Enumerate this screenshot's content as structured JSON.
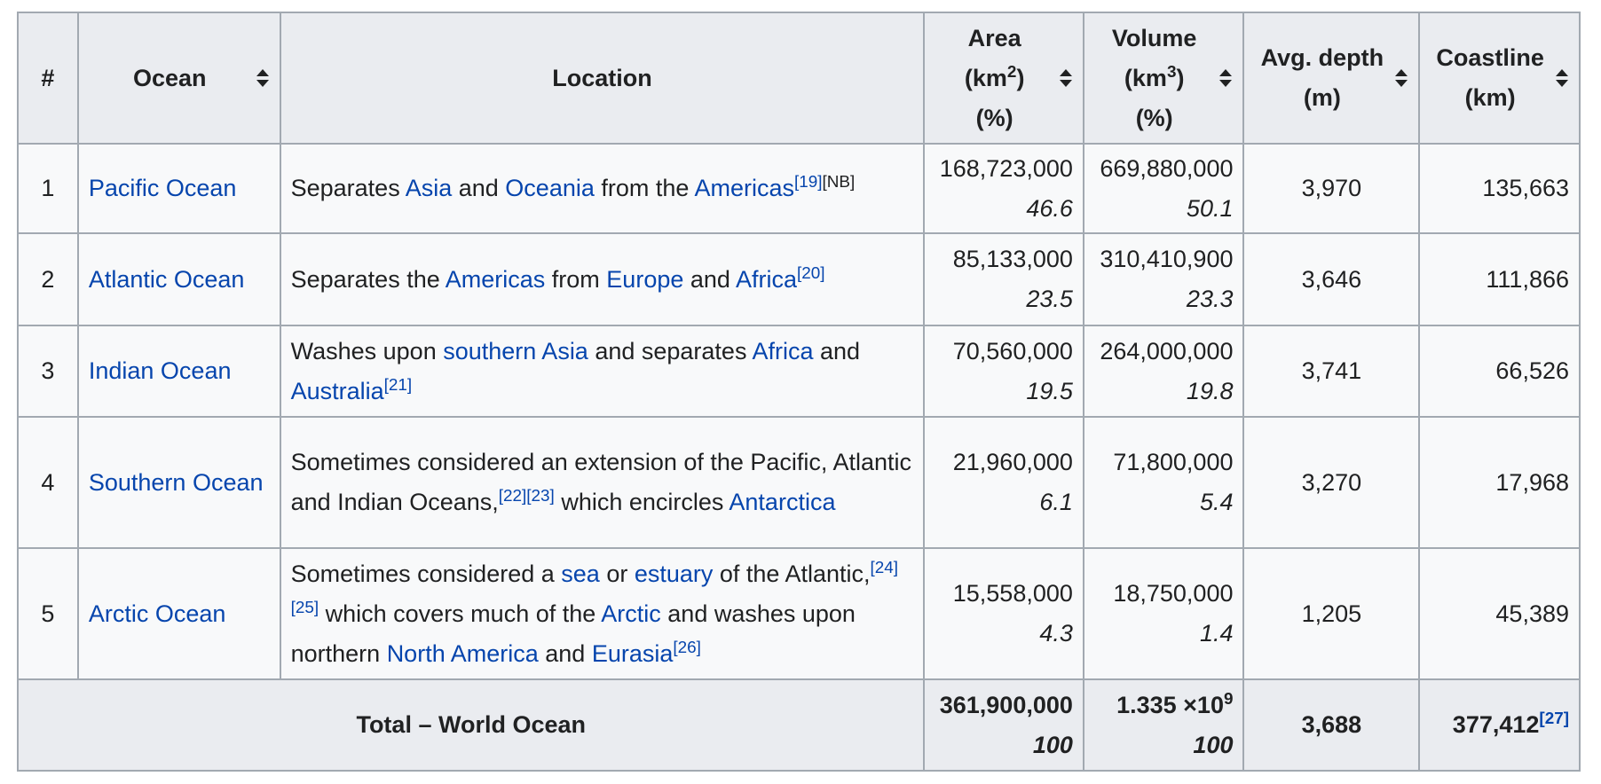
{
  "table": {
    "headers": {
      "rank": "#",
      "ocean": "Ocean",
      "location": "Location",
      "area_l1": "Area",
      "area_l2_pre": "(km",
      "area_l2_sup": "2",
      "area_l2_post": ")",
      "area_l3": "(%)",
      "volume_l1": "Volume",
      "volume_l2_pre": "(km",
      "volume_l2_sup": "3",
      "volume_l2_post": ")",
      "volume_l3": "(%)",
      "depth_l1": "Avg. depth",
      "depth_l2": "(m)",
      "coast_l1": "Coastline",
      "coast_l2": "(km)"
    },
    "rows": [
      {
        "rank": "1",
        "ocean": "Pacific Ocean",
        "location": {
          "t1": "Separates ",
          "l1": "Asia",
          "t2": " and ",
          "l2": "Oceania",
          "t3": " from the ",
          "l3": "Americas",
          "ref1": "[19]",
          "note": "[NB]"
        },
        "area": "168,723,000",
        "area_pct": "46.6",
        "volume": "669,880,000",
        "volume_pct": "50.1",
        "depth": "3,970",
        "coastline": "135,663"
      },
      {
        "rank": "2",
        "ocean": "Atlantic Ocean",
        "location": {
          "t1": "Separates the ",
          "l1": "Americas",
          "t2": " from ",
          "l2": "Europe",
          "t3": " and ",
          "l3": "Africa",
          "ref1": "[20]"
        },
        "area": "85,133,000",
        "area_pct": "23.5",
        "volume": "310,410,900",
        "volume_pct": "23.3",
        "depth": "3,646",
        "coastline": "111,866"
      },
      {
        "rank": "3",
        "ocean": "Indian Ocean",
        "location": {
          "t1": "Washes upon ",
          "l1": "southern Asia",
          "t2": " and separates ",
          "l2": "Africa",
          "t3": " and ",
          "l3": "Australia",
          "ref1": "[21]"
        },
        "area": "70,560,000",
        "area_pct": "19.5",
        "volume": "264,000,000",
        "volume_pct": "19.8",
        "depth": "3,741",
        "coastline": "66,526"
      },
      {
        "rank": "4",
        "ocean": "Southern Ocean",
        "location": {
          "t1": "Sometimes considered an extension of the Pacific, Atlantic and Indian Oceans,",
          "ref1": "[22]",
          "ref2": "[23]",
          "t2": " which encircles ",
          "l1": "Antarctica"
        },
        "area": "21,960,000",
        "area_pct": "6.1",
        "volume": "71,800,000",
        "volume_pct": "5.4",
        "depth": "3,270",
        "coastline": "17,968"
      },
      {
        "rank": "5",
        "ocean": "Arctic Ocean",
        "location": {
          "t1": "Sometimes considered a ",
          "l1": "sea",
          "t2": " or ",
          "l2": "estuary",
          "t3": " of the Atlantic,",
          "ref1": "[24]",
          "ref2": "[25]",
          "t4": " which covers much of the ",
          "l3": "Arctic",
          "t5": " and washes upon northern ",
          "l4": "North America",
          "t6": " and ",
          "l5": "Eurasia",
          "ref3": "[26]"
        },
        "area": "15,558,000",
        "area_pct": "4.3",
        "volume": "18,750,000",
        "volume_pct": "1.4",
        "depth": "1,205",
        "coastline": "45,389"
      }
    ],
    "total": {
      "label": "Total – World Ocean",
      "area": "361,900,000",
      "area_pct": "100",
      "volume_base": "1.335 ×10",
      "volume_exp": "9",
      "volume_pct": "100",
      "depth": "3,688",
      "coastline": "377,412",
      "coastline_ref": "[27]"
    }
  },
  "colors": {
    "link": "#0645ad",
    "text": "#202122",
    "header_bg": "#eaecf0",
    "cell_bg": "#f8f9fa",
    "border": "#a2a9b1"
  }
}
